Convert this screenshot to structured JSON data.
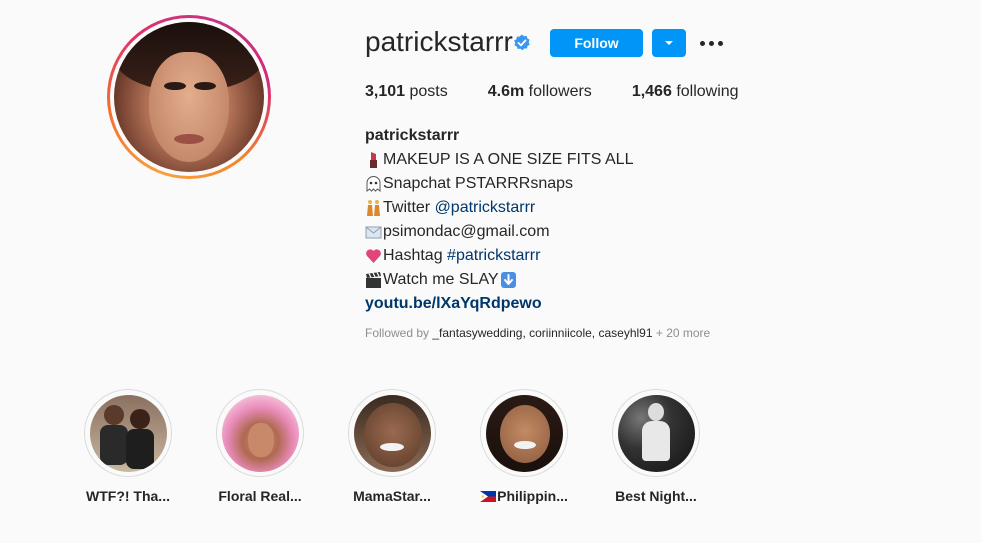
{
  "profile": {
    "username": "patrickstarrr",
    "follow_label": "Follow",
    "stats": {
      "posts_value": "3,101",
      "posts_label": "posts",
      "followers_value": "4.6m",
      "followers_label": "followers",
      "following_value": "1,466",
      "following_label": "following"
    }
  },
  "bio": {
    "name": "patrickstarrr",
    "line1": "MAKEUP IS A ONE SIZE FITS ALL",
    "line2": "Snapchat PSTARRRsnaps",
    "line3_text": "Twitter ",
    "line3_link": "@patrickstarrr",
    "line4": "psimondac@gmail.com",
    "line5_text": "Hashtag ",
    "line5_link": "#patrickstarrr",
    "line6": "Watch me SLAY",
    "url": "youtu.be/lXaYqRdpewo",
    "icons": [
      "lipstick-icon",
      "ghost-icon",
      "dancers-icon",
      "envelope-icon",
      "heart-icon",
      "clapper-icon",
      "down-arrow-icon"
    ]
  },
  "followed_by": {
    "prefix": "Followed by ",
    "names": "_fantasywedding, coriinniicole, caseyhl91",
    "more": " + 20 more"
  },
  "highlights": [
    {
      "label": "WTF?! Tha..."
    },
    {
      "label": "Floral Real..."
    },
    {
      "label": "MamaStar..."
    },
    {
      "label": "Philippin..."
    },
    {
      "label": "Best Night..."
    }
  ],
  "colors": {
    "accent": "#0095f6",
    "link": "#00376b",
    "muted": "#8e8e8e",
    "background": "#fafafa"
  }
}
